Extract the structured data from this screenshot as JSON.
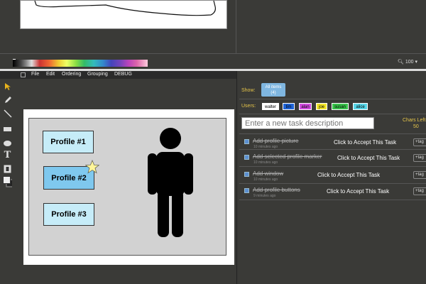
{
  "top_pane": {
    "zoom_label": "100"
  },
  "menu": {
    "items": [
      "File",
      "Edit",
      "Ordering",
      "Grouping",
      "DEBUG"
    ]
  },
  "canvas": {
    "profiles": [
      {
        "label": "Profile #1",
        "selected": false
      },
      {
        "label": "Profile #2",
        "selected": true
      },
      {
        "label": "Profile #3",
        "selected": false
      }
    ]
  },
  "tasks": {
    "show_label": "Show:",
    "show_button": {
      "line1": "All items",
      "line2": "(4)"
    },
    "users_label": "Users:",
    "users": [
      {
        "name": "walter",
        "color": "#ffffff"
      },
      {
        "name": "tim",
        "color": "#1e63d6"
      },
      {
        "name": "alan",
        "color": "#d24be0"
      },
      {
        "name": "joe",
        "color": "#f3e62a"
      },
      {
        "name": "susan",
        "color": "#38c24a"
      },
      {
        "name": "alice",
        "color": "#57d6e8"
      }
    ],
    "input_placeholder": "Enter a new task description",
    "chars_left_label": "Chars Left",
    "chars_left_value": "50",
    "items": [
      {
        "title": "Add profile picture",
        "time": "10 minutes ago",
        "action": "Click to Accept This Task",
        "tag": "+tag"
      },
      {
        "title": "Add selected profile marker",
        "time": "10 minutes ago",
        "action": "Click to Accept This Task",
        "tag": "+tag"
      },
      {
        "title": "Add window",
        "time": "10 minutes ago",
        "action": "Click to Accept This Task",
        "tag": "+tag"
      },
      {
        "title": "Add profile buttons",
        "time": "9 minutes ago",
        "action": "Click to Accept This Task",
        "tag": "+tag"
      }
    ]
  }
}
